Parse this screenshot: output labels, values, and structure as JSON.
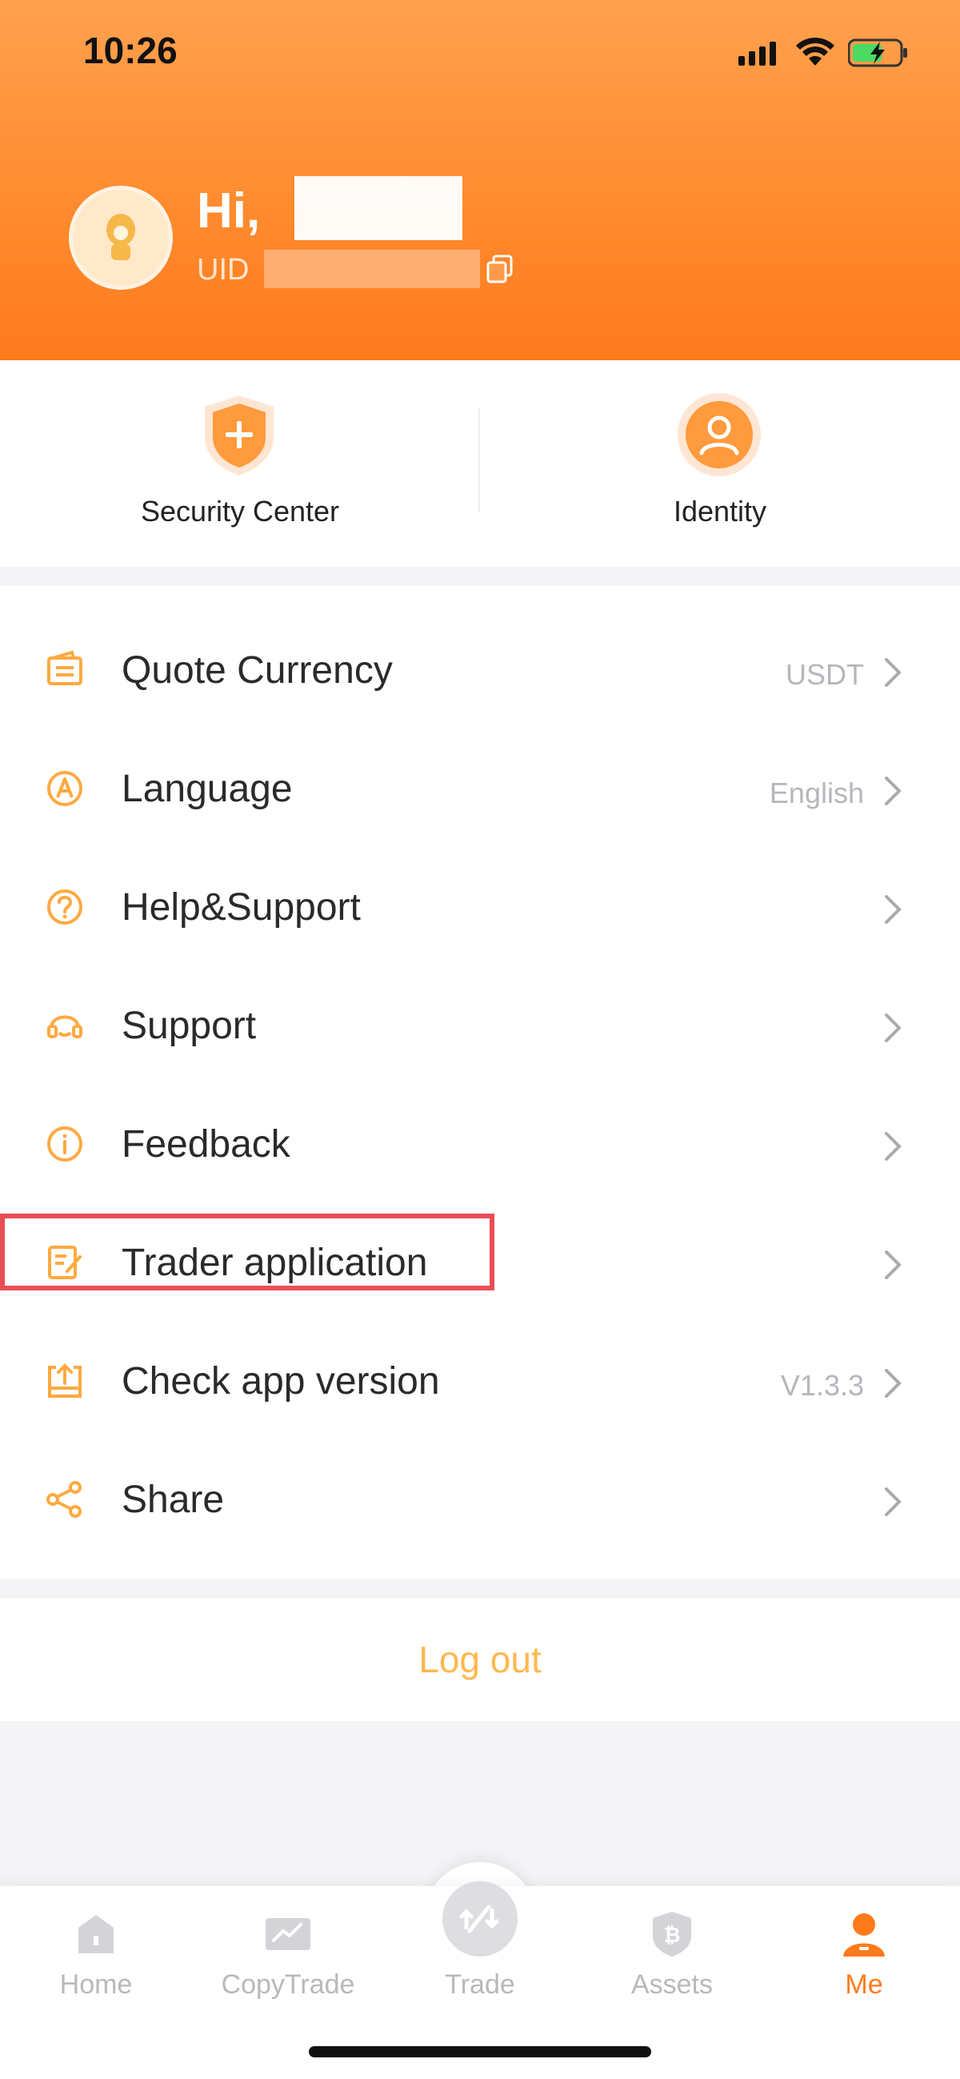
{
  "status_bar": {
    "time": "10:26"
  },
  "profile": {
    "greeting": "Hi,",
    "uid_prefix": "UID"
  },
  "quick_actions": [
    {
      "label": "Security Center",
      "icon": "shield-plus-icon"
    },
    {
      "label": "Identity",
      "icon": "user-circle-icon"
    }
  ],
  "menu": [
    {
      "label": "Quote Currency",
      "value": "USDT",
      "icon": "wallet-icon"
    },
    {
      "label": "Language",
      "value": "English",
      "icon": "language-icon"
    },
    {
      "label": "Help&Support",
      "value": "",
      "icon": "help-icon"
    },
    {
      "label": "Support",
      "value": "",
      "icon": "headset-icon"
    },
    {
      "label": "Feedback",
      "value": "",
      "icon": "info-icon"
    },
    {
      "label": "Trader application",
      "value": "",
      "icon": "edit-document-icon"
    },
    {
      "label": "Check app version",
      "value": "V1.3.3",
      "icon": "upload-icon"
    },
    {
      "label": "Share",
      "value": "",
      "icon": "share-icon"
    }
  ],
  "logout_label": "Log out",
  "tabs": [
    {
      "label": "Home",
      "icon": "home-icon",
      "active": false
    },
    {
      "label": "CopyTrade",
      "icon": "copytrade-icon",
      "active": false
    },
    {
      "label": "Trade",
      "icon": "trade-icon",
      "active": false
    },
    {
      "label": "Assets",
      "icon": "bitcoin-shield-icon",
      "active": false
    },
    {
      "label": "Me",
      "icon": "person-icon",
      "active": true
    }
  ],
  "colors": {
    "accent": "#ff7a1a",
    "icon_orange": "#ffa940",
    "logout": "#ffb84f",
    "highlight_box": "#e94e56"
  }
}
